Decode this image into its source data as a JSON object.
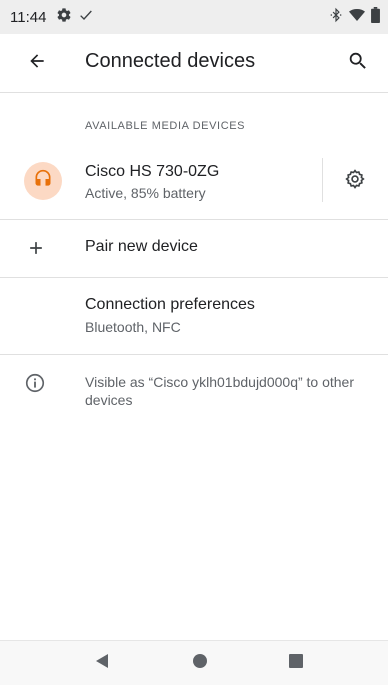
{
  "status_bar": {
    "time": "11:44",
    "left_icons": [
      "settings-gear-icon",
      "checkmark-icon"
    ],
    "right_icons": [
      "bluetooth-icon",
      "wifi-icon",
      "battery-icon"
    ]
  },
  "app_bar": {
    "title": "Connected devices",
    "back_icon": "arrow-back-icon",
    "search_icon": "search-icon"
  },
  "available_section": {
    "header": "AVAILABLE MEDIA DEVICES",
    "device": {
      "name": "Cisco HS 730-0ZG",
      "status": "Active, 85% battery",
      "icon": "headset-icon",
      "icon_bg_color": "#fcd9c4",
      "icon_color": "#e8710a",
      "settings_icon": "gear-icon"
    }
  },
  "pair_new": {
    "label": "Pair new device",
    "icon": "plus-icon"
  },
  "connection_preferences": {
    "title": "Connection preferences",
    "summary": "Bluetooth, NFC"
  },
  "info": {
    "icon": "info-icon",
    "text": "Visible as “Cisco yklh01bdujd000q” to other devices"
  },
  "nav_bar": {
    "back_icon": "nav-back-icon",
    "home_icon": "nav-home-icon",
    "recents_icon": "nav-recents-icon"
  }
}
